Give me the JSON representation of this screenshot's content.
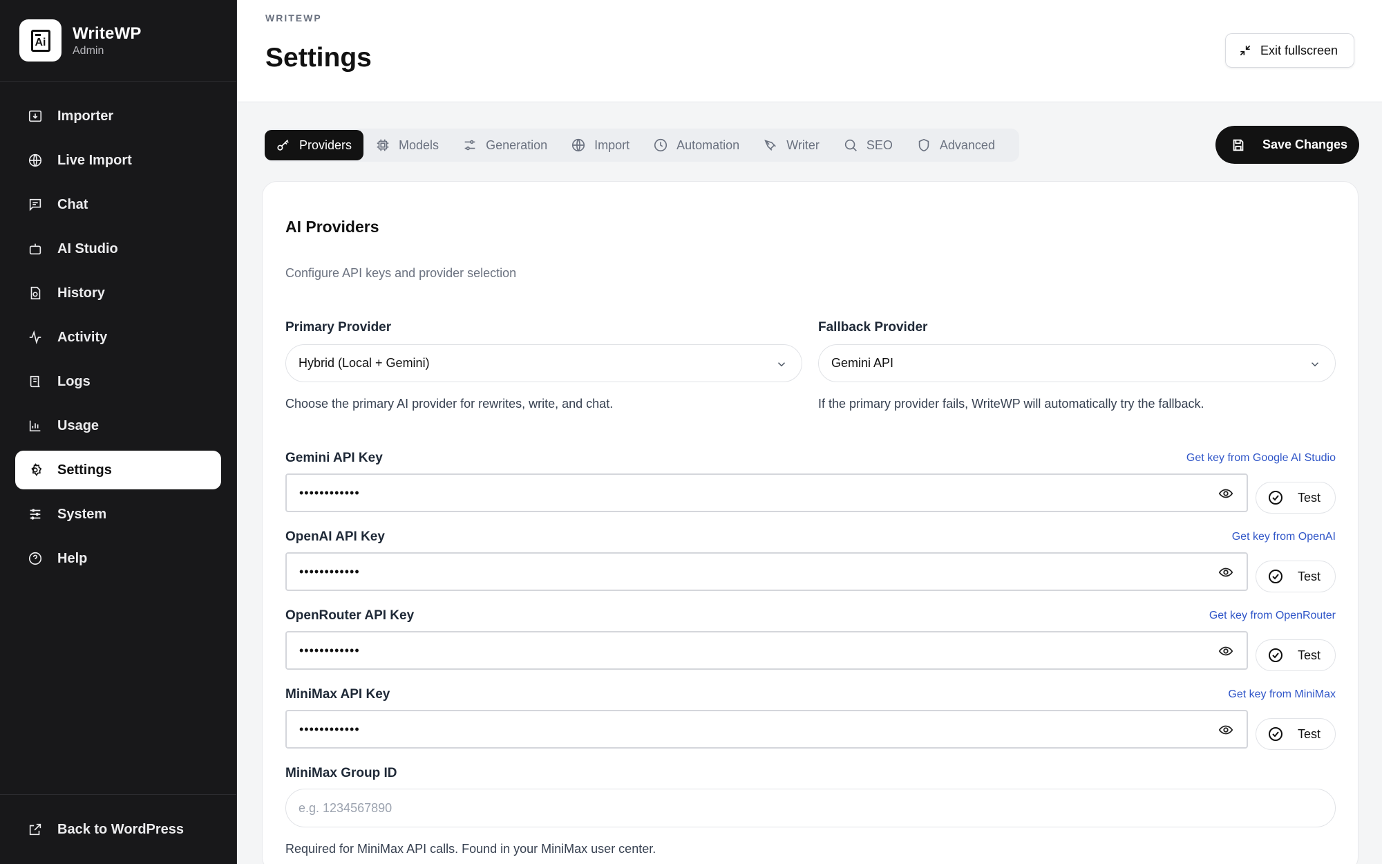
{
  "brand": {
    "name": "WriteWP",
    "subtitle": "Admin",
    "logo_text": "Ai"
  },
  "sidebar": {
    "items": [
      {
        "label": "Importer",
        "icon": "import-icon"
      },
      {
        "label": "Live Import",
        "icon": "globe-icon"
      },
      {
        "label": "Chat",
        "icon": "chat-icon"
      },
      {
        "label": "AI Studio",
        "icon": "robot-icon"
      },
      {
        "label": "History",
        "icon": "history-icon"
      },
      {
        "label": "Activity",
        "icon": "activity-icon"
      },
      {
        "label": "Logs",
        "icon": "logs-icon"
      },
      {
        "label": "Usage",
        "icon": "bar-chart-icon"
      },
      {
        "label": "Settings",
        "icon": "gear-icon",
        "active": true
      },
      {
        "label": "System",
        "icon": "sliders-icon"
      },
      {
        "label": "Help",
        "icon": "help-circle-icon"
      }
    ],
    "footer": {
      "label": "Back to WordPress",
      "icon": "external-link-icon"
    }
  },
  "header": {
    "breadcrumb": "WRITEWP",
    "title": "Settings",
    "exit_label": "Exit fullscreen"
  },
  "tabs": [
    {
      "label": "Providers",
      "icon": "key-icon",
      "active": true
    },
    {
      "label": "Models",
      "icon": "chip-icon"
    },
    {
      "label": "Generation",
      "icon": "sliders-icon"
    },
    {
      "label": "Import",
      "icon": "globe-icon"
    },
    {
      "label": "Automation",
      "icon": "clock-icon"
    },
    {
      "label": "Writer",
      "icon": "pen-icon"
    },
    {
      "label": "SEO",
      "icon": "search-icon"
    },
    {
      "label": "Advanced",
      "icon": "shield-icon"
    }
  ],
  "save_label": "Save Changes",
  "card": {
    "title": "AI Providers",
    "description": "Configure API keys and provider selection",
    "primary": {
      "label": "Primary Provider",
      "value": "Hybrid (Local + Gemini)",
      "help": "Choose the primary AI provider for rewrites, write, and chat."
    },
    "fallback": {
      "label": "Fallback Provider",
      "value": "Gemini API",
      "help": "If the primary provider fails, WriteWP will automatically try the fallback."
    },
    "keys": [
      {
        "label": "Gemini API Key",
        "link": "Get key from Google AI Studio",
        "value": "••••••••••••",
        "test": "Test"
      },
      {
        "label": "OpenAI API Key",
        "link": "Get key from OpenAI",
        "value": "••••••••••••",
        "test": "Test"
      },
      {
        "label": "OpenRouter API Key",
        "link": "Get key from OpenRouter",
        "value": "••••••••••••",
        "test": "Test"
      },
      {
        "label": "MiniMax API Key",
        "link": "Get key from MiniMax",
        "value": "••••••••••••",
        "test": "Test"
      }
    ],
    "group": {
      "label": "MiniMax Group ID",
      "placeholder": "e.g. 1234567890",
      "help": "Required for MiniMax API calls. Found in your MiniMax user center."
    }
  }
}
